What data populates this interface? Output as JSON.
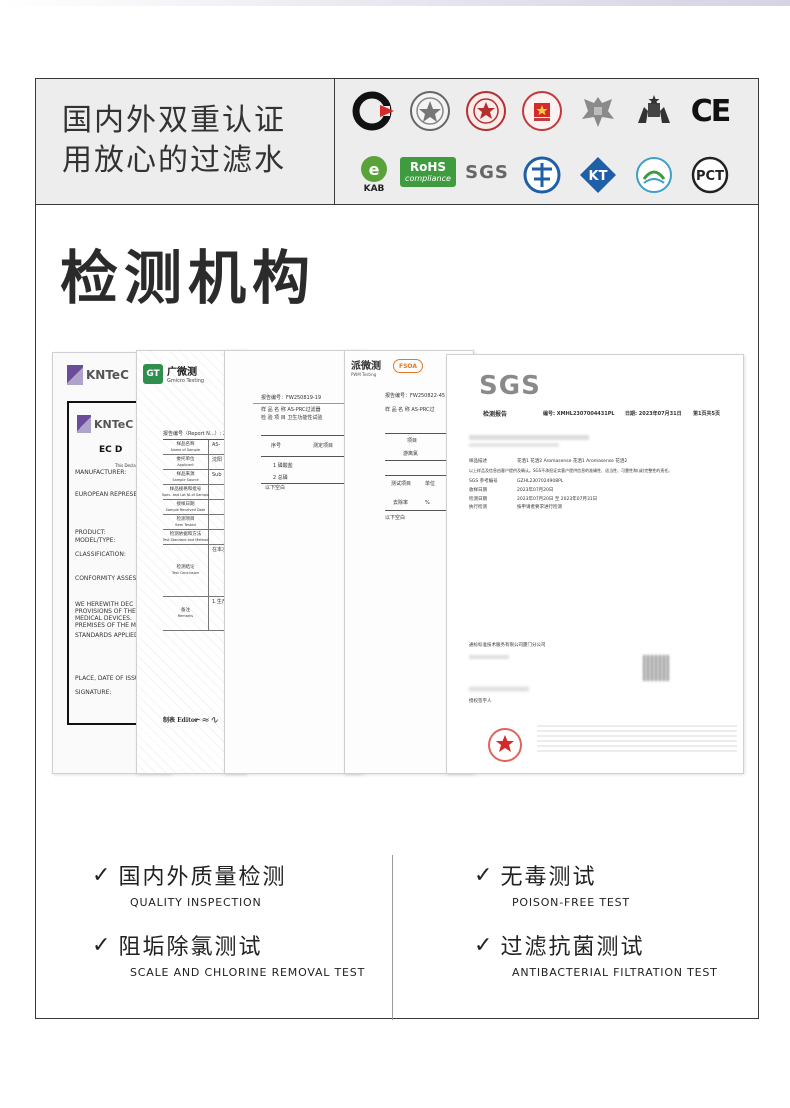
{
  "header": {
    "line1": "国内外双重认证",
    "line2": "用放心的过滤水"
  },
  "badges": {
    "icons": [
      "china-compulsory-cert-icon",
      "national-emblem-seal-icon",
      "red-seal-icon",
      "china-emblem-icon",
      "russian-eagle-icon",
      "australia-crest-icon",
      "ce-mark-icon",
      "kab-icon",
      "rohs-icon",
      "sgs-icon",
      "ks-mark-icon",
      "kt-icon",
      "eco-label-icon",
      "pct-icon"
    ],
    "ce": "CE",
    "kab": "KAB",
    "rohs_top": "RoHS",
    "rohs_bottom": "compliance",
    "sgs": "SGS",
    "kt": "KT",
    "pct": "PCT"
  },
  "section_title": "检测机构",
  "documents": {
    "kntec": {
      "logo": "KNTeC",
      "inner_logo": "KNTeC",
      "heading": "EC D",
      "declaration": "This Declaration",
      "fields": [
        "MANUFACTURER:",
        "EUROPEAN REPRESE",
        "PRODUCT:",
        "MODEL/TYPE:",
        "CLASSIFICATION:",
        "CONFORMITY ASSES",
        "WE HEREWITH DEC",
        "PROVISIONS OF THE",
        "MEDICAL DEVICES.",
        "PREMISES OF THE M",
        "STANDARDS APPLIED",
        "PLACE, DATE OF ISSU",
        "SIGNATURE:"
      ]
    },
    "gmicro": {
      "logo_short": "GT",
      "logo_cn": "广微测",
      "logo_en": "Gmicro Testing",
      "report_no": "报告编号（Report N...）: 2",
      "rows": [
        [
          "样品名称",
          "Name of Sample",
          "AS-"
        ],
        [
          "委托单位",
          "Applicant",
          "沈阳"
        ],
        [
          "样品来源",
          "Sample Source",
          "Sub"
        ],
        [
          "样品规格和批号",
          "Spec. and Lot № of Sample",
          ""
        ],
        [
          "接样日期",
          "Sample Received Date",
          ""
        ],
        [
          "检测项目",
          "Item Tested",
          ""
        ],
        [
          "检测依据和方法",
          "Test Standard and Method",
          ""
        ],
        [
          "检测结论",
          "Test Conclusion",
          "在本次..."
        ],
        [
          "备注",
          "Remarks",
          "1.生产..."
        ]
      ],
      "editor": "制表 Editor"
    },
    "report3": {
      "report_no": "报告编号：FW250819-19",
      "sample": "样 品 名 称   AS-PRC过滤器",
      "check": "检 验 项 目   卫生功能性试验",
      "col1": "序号",
      "col2": "测定项目",
      "items": [
        "1  磷酸盐",
        "2  总磷"
      ],
      "footer": "以下空白"
    },
    "fsoa": {
      "logo_cn": "派微测",
      "logo_en": "PWM Testing",
      "badge": "FSOA",
      "report_no": "报告编号：FW250822-45",
      "sample": "样 品 名 称  AS-PRC过",
      "item": "项目",
      "item_value": "游离氯",
      "test_method": "测试项目",
      "unit": "单位",
      "result": "去除率",
      "result_unit": "%",
      "footer": "以下空白"
    },
    "sgs": {
      "logo": "SGS",
      "title": "检测报告",
      "report_no": "编号: XMHL2307004431PL",
      "date": "日期: 2023年07月31日",
      "pages": "第1页共5页",
      "fields": [
        [
          "样品描述",
          "花洒1 花洒2 Aromasense 花洒1 Aromasense 花洒2"
        ],
        [
          "SGS 参考编号",
          "GZHL2307024908PL"
        ],
        [
          "收样日期",
          "2023年07月20日"
        ],
        [
          "检测日期",
          "2023年07月20日 至 2023年07月31日"
        ],
        [
          "执行检测",
          "按申请者要求进行检测"
        ]
      ],
      "note": "以上样品及信息由客户提供及确认。SGS不承担证实客户提供信息的准确性、适当性、可靠性和(或)完整性的责任。",
      "company": "通标标准技术服务有限公司厦门分公司",
      "sign_title": "授权签字人"
    }
  },
  "features": [
    {
      "title": "国内外质量检测",
      "subtitle": "QUALITY INSPECTION"
    },
    {
      "title": "无毒测试",
      "subtitle": "POISON-FREE TEST"
    },
    {
      "title": "阻垢除氯测试",
      "subtitle": "SCALE AND CHLORINE REMOVAL TEST"
    },
    {
      "title": "过滤抗菌测试",
      "subtitle": "ANTIBACTERIAL FILTRATION TEST"
    }
  ],
  "features_check": "✓",
  "colors": {
    "border": "#3a3a3a",
    "header_bg": "#ededed",
    "red": "#d32a2a",
    "green": "#3e9b3e",
    "blue": "#1e5fa8"
  }
}
